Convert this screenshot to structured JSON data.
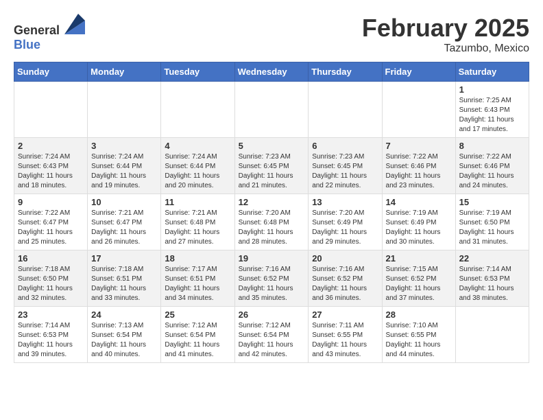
{
  "logo": {
    "text_general": "General",
    "text_blue": "Blue"
  },
  "header": {
    "month_title": "February 2025",
    "location": "Tazumbo, Mexico"
  },
  "weekdays": [
    "Sunday",
    "Monday",
    "Tuesday",
    "Wednesday",
    "Thursday",
    "Friday",
    "Saturday"
  ],
  "weeks": [
    [
      {
        "day": "",
        "info": ""
      },
      {
        "day": "",
        "info": ""
      },
      {
        "day": "",
        "info": ""
      },
      {
        "day": "",
        "info": ""
      },
      {
        "day": "",
        "info": ""
      },
      {
        "day": "",
        "info": ""
      },
      {
        "day": "1",
        "info": "Sunrise: 7:25 AM\nSunset: 6:43 PM\nDaylight: 11 hours and 17 minutes."
      }
    ],
    [
      {
        "day": "2",
        "info": "Sunrise: 7:24 AM\nSunset: 6:43 PM\nDaylight: 11 hours and 18 minutes."
      },
      {
        "day": "3",
        "info": "Sunrise: 7:24 AM\nSunset: 6:44 PM\nDaylight: 11 hours and 19 minutes."
      },
      {
        "day": "4",
        "info": "Sunrise: 7:24 AM\nSunset: 6:44 PM\nDaylight: 11 hours and 20 minutes."
      },
      {
        "day": "5",
        "info": "Sunrise: 7:23 AM\nSunset: 6:45 PM\nDaylight: 11 hours and 21 minutes."
      },
      {
        "day": "6",
        "info": "Sunrise: 7:23 AM\nSunset: 6:45 PM\nDaylight: 11 hours and 22 minutes."
      },
      {
        "day": "7",
        "info": "Sunrise: 7:22 AM\nSunset: 6:46 PM\nDaylight: 11 hours and 23 minutes."
      },
      {
        "day": "8",
        "info": "Sunrise: 7:22 AM\nSunset: 6:46 PM\nDaylight: 11 hours and 24 minutes."
      }
    ],
    [
      {
        "day": "9",
        "info": "Sunrise: 7:22 AM\nSunset: 6:47 PM\nDaylight: 11 hours and 25 minutes."
      },
      {
        "day": "10",
        "info": "Sunrise: 7:21 AM\nSunset: 6:47 PM\nDaylight: 11 hours and 26 minutes."
      },
      {
        "day": "11",
        "info": "Sunrise: 7:21 AM\nSunset: 6:48 PM\nDaylight: 11 hours and 27 minutes."
      },
      {
        "day": "12",
        "info": "Sunrise: 7:20 AM\nSunset: 6:48 PM\nDaylight: 11 hours and 28 minutes."
      },
      {
        "day": "13",
        "info": "Sunrise: 7:20 AM\nSunset: 6:49 PM\nDaylight: 11 hours and 29 minutes."
      },
      {
        "day": "14",
        "info": "Sunrise: 7:19 AM\nSunset: 6:49 PM\nDaylight: 11 hours and 30 minutes."
      },
      {
        "day": "15",
        "info": "Sunrise: 7:19 AM\nSunset: 6:50 PM\nDaylight: 11 hours and 31 minutes."
      }
    ],
    [
      {
        "day": "16",
        "info": "Sunrise: 7:18 AM\nSunset: 6:50 PM\nDaylight: 11 hours and 32 minutes."
      },
      {
        "day": "17",
        "info": "Sunrise: 7:18 AM\nSunset: 6:51 PM\nDaylight: 11 hours and 33 minutes."
      },
      {
        "day": "18",
        "info": "Sunrise: 7:17 AM\nSunset: 6:51 PM\nDaylight: 11 hours and 34 minutes."
      },
      {
        "day": "19",
        "info": "Sunrise: 7:16 AM\nSunset: 6:52 PM\nDaylight: 11 hours and 35 minutes."
      },
      {
        "day": "20",
        "info": "Sunrise: 7:16 AM\nSunset: 6:52 PM\nDaylight: 11 hours and 36 minutes."
      },
      {
        "day": "21",
        "info": "Sunrise: 7:15 AM\nSunset: 6:52 PM\nDaylight: 11 hours and 37 minutes."
      },
      {
        "day": "22",
        "info": "Sunrise: 7:14 AM\nSunset: 6:53 PM\nDaylight: 11 hours and 38 minutes."
      }
    ],
    [
      {
        "day": "23",
        "info": "Sunrise: 7:14 AM\nSunset: 6:53 PM\nDaylight: 11 hours and 39 minutes."
      },
      {
        "day": "24",
        "info": "Sunrise: 7:13 AM\nSunset: 6:54 PM\nDaylight: 11 hours and 40 minutes."
      },
      {
        "day": "25",
        "info": "Sunrise: 7:12 AM\nSunset: 6:54 PM\nDaylight: 11 hours and 41 minutes."
      },
      {
        "day": "26",
        "info": "Sunrise: 7:12 AM\nSunset: 6:54 PM\nDaylight: 11 hours and 42 minutes."
      },
      {
        "day": "27",
        "info": "Sunrise: 7:11 AM\nSunset: 6:55 PM\nDaylight: 11 hours and 43 minutes."
      },
      {
        "day": "28",
        "info": "Sunrise: 7:10 AM\nSunset: 6:55 PM\nDaylight: 11 hours and 44 minutes."
      },
      {
        "day": "",
        "info": ""
      }
    ]
  ]
}
